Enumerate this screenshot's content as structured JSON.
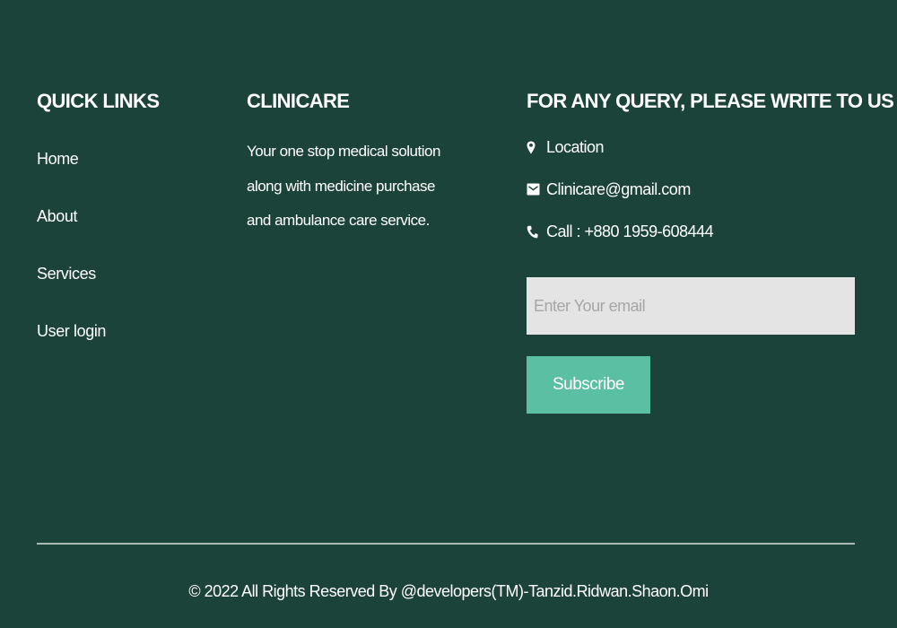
{
  "quick_links": {
    "title": "QUICK LINKS",
    "items": [
      {
        "label": "Home"
      },
      {
        "label": "About"
      },
      {
        "label": "Services"
      },
      {
        "label": "User login"
      }
    ]
  },
  "about": {
    "title": "CLINICARE",
    "text": "Your one stop medical solution along with medicine purchase and ambulance care service."
  },
  "contact": {
    "title": "FOR ANY QUERY, PLEASE WRITE TO US",
    "location": "Location",
    "email": "Clinicare@gmail.com",
    "phone": "Call : +880 1959-608444",
    "icons": {
      "location": "map-pin-icon",
      "email": "envelope-icon",
      "phone": "phone-icon"
    }
  },
  "subscribe": {
    "placeholder": "Enter Your email",
    "value": "",
    "button_label": "Subscribe"
  },
  "footer": {
    "copyright": "© 2022 All Rights Reserved By @developers(TM)-Tanzid.Ridwan.Shaon.Omi"
  },
  "colors": {
    "background": "#1c4339",
    "text": "#ffffff",
    "button": "#5abfa3",
    "input_background": "#e4e4e4",
    "placeholder": "#a6a6a6",
    "divider": "#aab8b2"
  }
}
